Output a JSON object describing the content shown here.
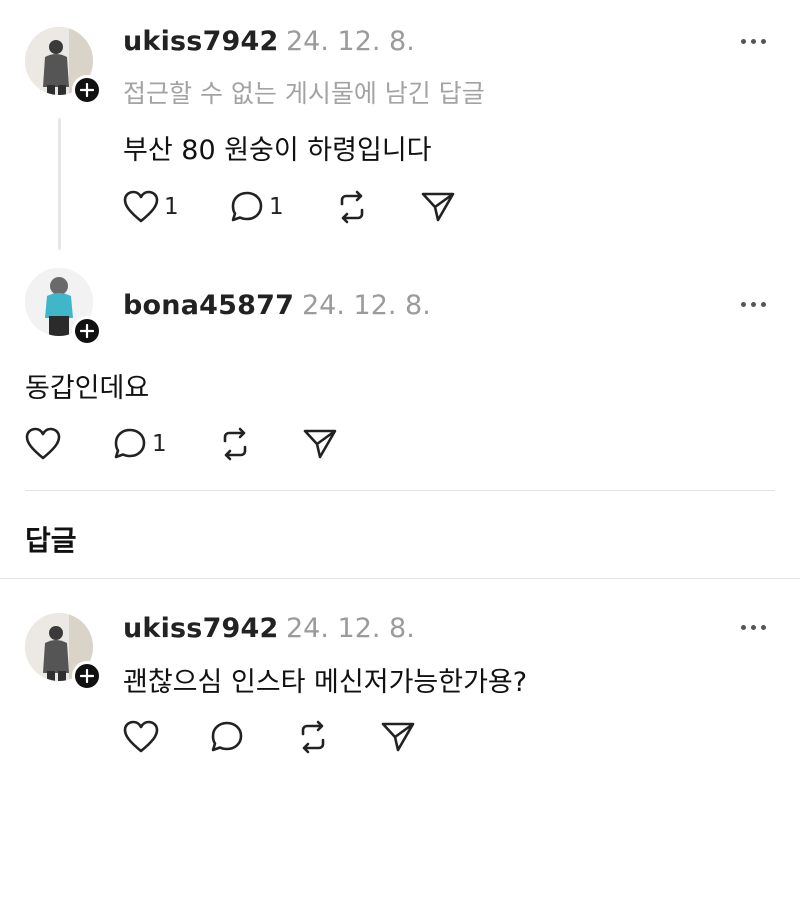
{
  "comments": [
    {
      "username": "ukiss7942",
      "date": "24. 12. 8.",
      "context": "접근할 수 없는 게시물에 남긴 답글",
      "text": "부산 80 원숭이 하령입니다",
      "likes": "1",
      "replies": "1"
    },
    {
      "username": "bona45877",
      "date": "24. 12. 8.",
      "text": "동갑인데요",
      "replies": "1"
    }
  ],
  "replies_section": {
    "title": "답글"
  },
  "reply": {
    "username": "ukiss7942",
    "date": "24. 12. 8.",
    "text": "괜찮으심 인스타 메신저가능한가용?"
  },
  "icons": {
    "like": "heart-icon",
    "reply": "comment-bubble-icon",
    "repost": "repost-icon",
    "share": "send-icon",
    "more": "more-dots-icon",
    "follow": "plus-icon"
  }
}
